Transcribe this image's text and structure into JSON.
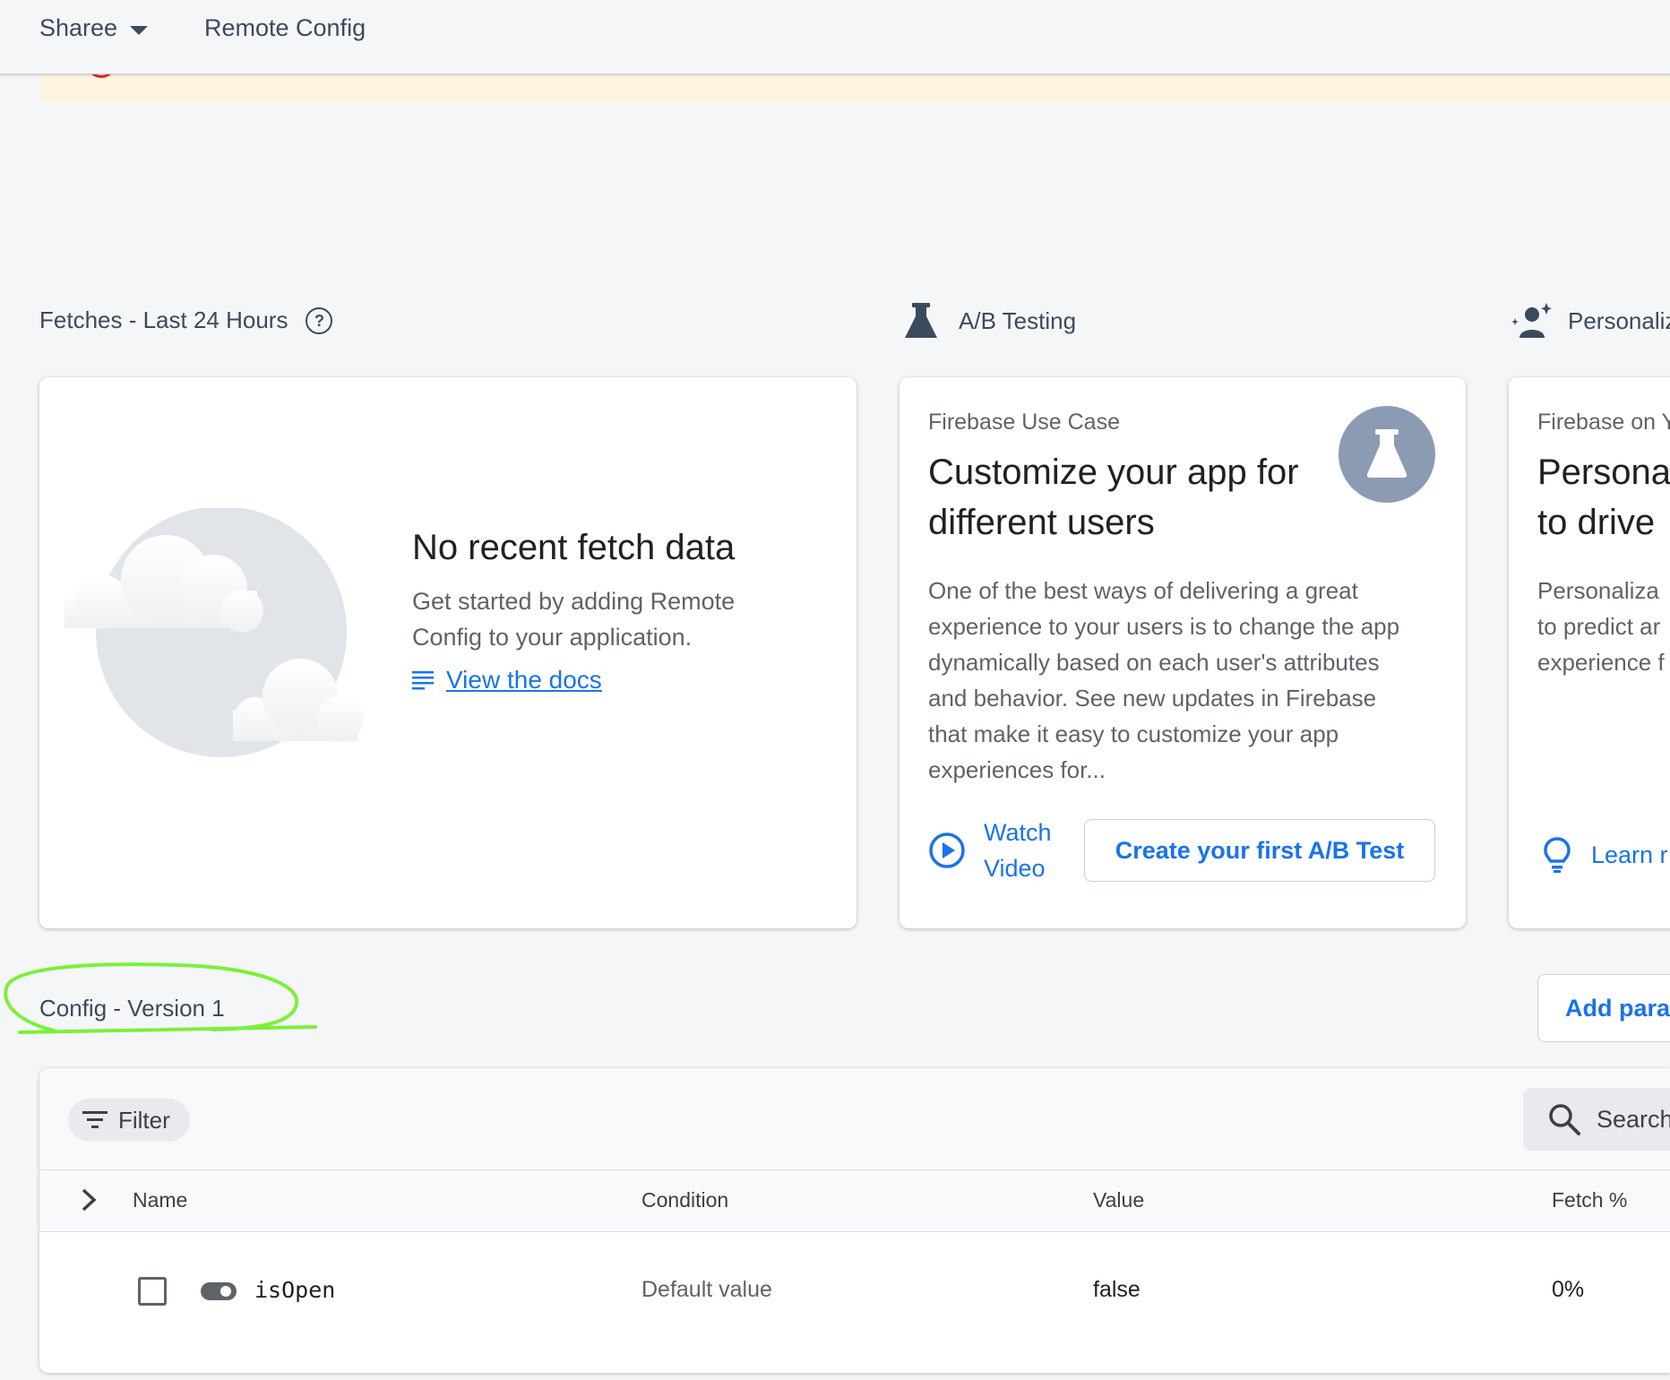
{
  "header": {
    "project_name": "Sharee",
    "breadcrumb": "Remote Config"
  },
  "fetches": {
    "title": "Fetches - Last 24 Hours",
    "empty_title": "No recent fetch data",
    "empty_desc_line1": "Get started by adding Remote",
    "empty_desc_line2": "Config to your application.",
    "docs_link": "View the docs"
  },
  "ab_testing": {
    "section_title": "A/B Testing",
    "eyebrow": "Firebase Use Case",
    "title_line1": "Customize your app for",
    "title_line2": "different users",
    "body": [
      "One of the best ways of delivering a great",
      "experience to your users is to change the app",
      "dynamically based on each user's attributes",
      "and behavior. See new updates in Firebase",
      "that make it easy to customize your app",
      "experiences for..."
    ],
    "watch_line1": "Watch",
    "watch_line2": "Video",
    "create_button": "Create your first A/B Test"
  },
  "personalization": {
    "section_title": "Personaliz",
    "eyebrow": "Firebase on Y",
    "title_line1": "Personal",
    "title_line2": "to drive",
    "body": [
      "Personaliza",
      "to predict ar",
      "experience f"
    ],
    "learn": "Learn r"
  },
  "config": {
    "title": "Config - Version 1",
    "add_button": "Add para",
    "filter_label": "Filter",
    "search_placeholder": "Search",
    "columns": [
      "Name",
      "Condition",
      "Value",
      "Fetch %"
    ],
    "rows": [
      {
        "name": "isOpen",
        "condition": "Default value",
        "value": "false",
        "fetch": "0%"
      }
    ]
  },
  "colors": {
    "accent": "#1a73e8",
    "banner": "#fdf3e1",
    "annotation": "#7bf03a",
    "icon_slate": "#3c4a5d"
  }
}
